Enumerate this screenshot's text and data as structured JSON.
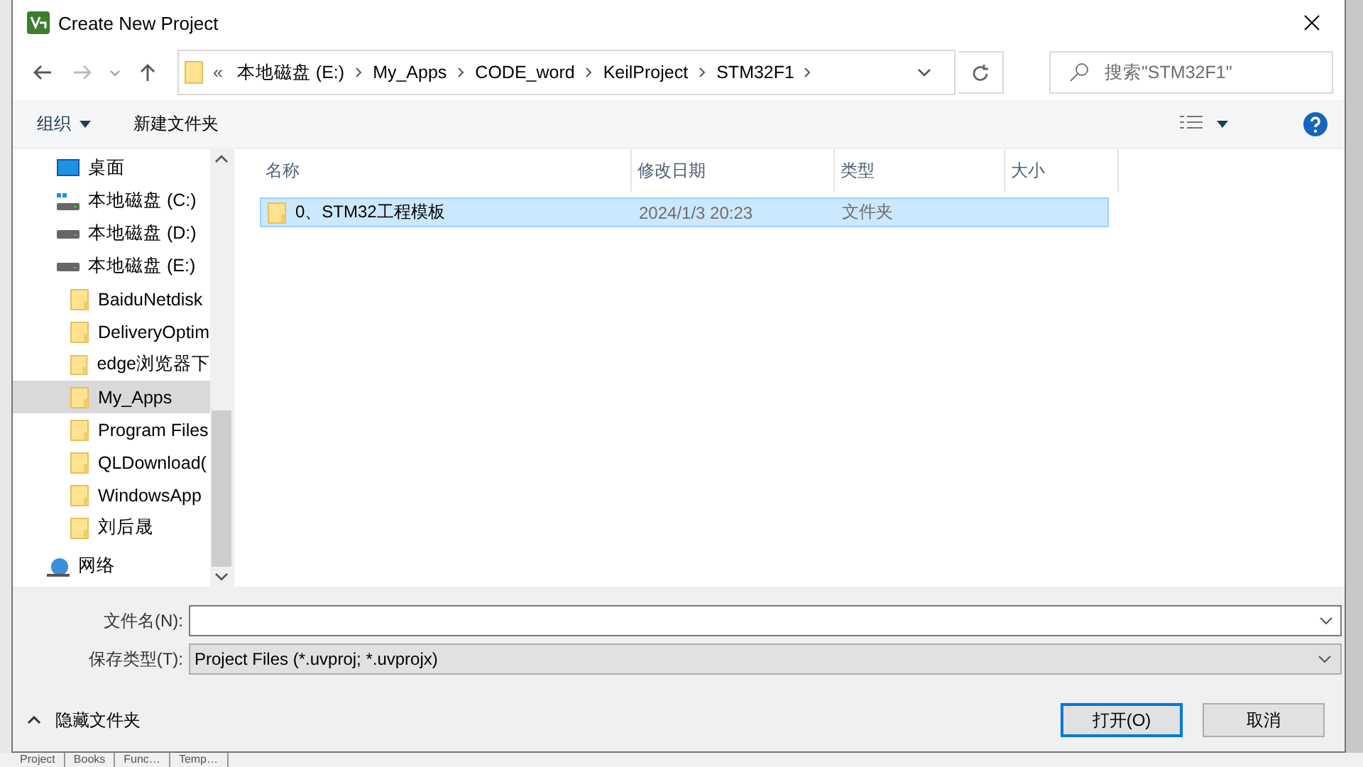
{
  "window": {
    "title": "Create New Project"
  },
  "address": {
    "overflow": "«",
    "crumbs": [
      "本地磁盘 (E:)",
      "My_Apps",
      "CODE_word",
      "KeilProject",
      "STM32F1"
    ]
  },
  "search": {
    "placeholder": "搜索\"STM32F1\""
  },
  "toolbar": {
    "organize": "组织",
    "new_folder": "新建文件夹"
  },
  "tree": [
    {
      "label": "桌面",
      "kind": "desktop",
      "selected": false
    },
    {
      "label": "本地磁盘 (C:)",
      "kind": "system-drive",
      "selected": false
    },
    {
      "label": "本地磁盘 (D:)",
      "kind": "drive",
      "selected": false
    },
    {
      "label": "本地磁盘 (E:)",
      "kind": "drive",
      "selected": false,
      "children": [
        {
          "label": "BaiduNetdisk",
          "kind": "folder",
          "selected": false
        },
        {
          "label": "DeliveryOptim",
          "kind": "folder",
          "selected": false
        },
        {
          "label": "edge浏览器下",
          "kind": "folder",
          "selected": false
        },
        {
          "label": "My_Apps",
          "kind": "folder",
          "selected": true
        },
        {
          "label": "Program Files",
          "kind": "folder",
          "selected": false
        },
        {
          "label": "QLDownload(",
          "kind": "folder",
          "selected": false
        },
        {
          "label": "WindowsApp",
          "kind": "folder",
          "selected": false
        },
        {
          "label": "刘后晟",
          "kind": "folder",
          "selected": false
        }
      ]
    },
    {
      "label": "网络",
      "kind": "network",
      "selected": false
    }
  ],
  "table": {
    "columns": [
      "名称",
      "修改日期",
      "类型",
      "大小"
    ],
    "rows": [
      {
        "name": "0、STM32工程模板",
        "modified": "2024/1/3 20:23",
        "type": "文件夹",
        "selected": true
      }
    ]
  },
  "form": {
    "filename_label": "文件名(N):",
    "filetype_label": "保存类型(T):",
    "filetype_value": "Project Files (*.uvproj; *.uvprojx)"
  },
  "hide_folders": "隐藏文件夹",
  "buttons": [
    {
      "label": "打开(O)",
      "default": true
    },
    {
      "label": "取消",
      "default": false
    }
  ],
  "background_tabs": [
    "Project",
    "Books",
    "Func…",
    "Temp…"
  ]
}
